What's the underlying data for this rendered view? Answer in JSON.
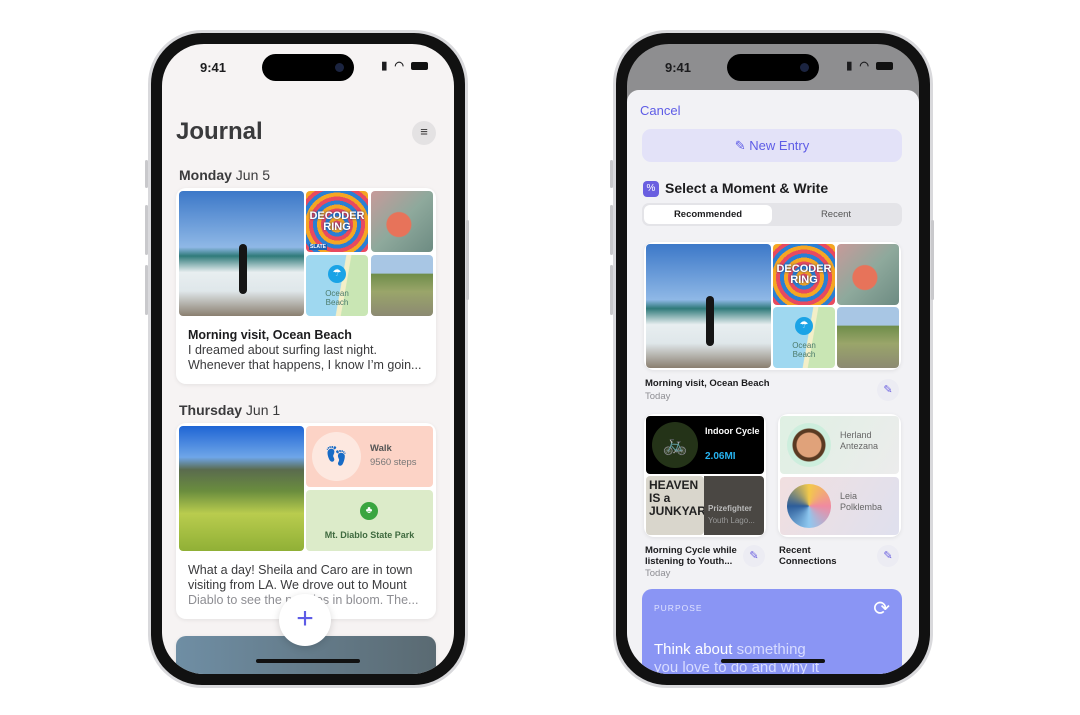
{
  "left_phone": {
    "status": {
      "time": "9:41"
    },
    "title": "Journal",
    "filter_icon": "line.3.horizontal.decrease-icon",
    "sections": [
      {
        "day": "Monday",
        "date": "Jun 5",
        "tiles": {
          "podcast": "DECODER RING",
          "podcast_publisher": "SLATE",
          "map_place": "Ocean Beach"
        },
        "entry_title": "Morning visit, Ocean Beach",
        "entry_lines": [
          "I dreamed about surfing last night.",
          "Whenever that happens, I know I’m goin..."
        ]
      },
      {
        "day": "Thursday",
        "date": "Jun 1",
        "tiles": {
          "activity": "Walk",
          "steps": "9560 steps",
          "map_place": "Mt. Diablo State Park"
        },
        "entry_lines": [
          "What a day! Sheila and Caro are in town",
          "visiting from LA. We drove out to Mount",
          "Diablo to see the poppies in bloom. The..."
        ]
      }
    ],
    "add_button": "+"
  },
  "right_phone": {
    "status": {
      "time": "9:41"
    },
    "cancel": "Cancel",
    "new_entry": "New Entry",
    "section_title": "Select a Moment & Write",
    "segments": [
      "Recommended",
      "Recent"
    ],
    "selected_segment": "Recommended",
    "moment1": {
      "title": "Morning visit, Ocean Beach",
      "subtitle": "Today",
      "podcast": "DECODER RING",
      "map_place": "Ocean Beach"
    },
    "moment2": {
      "workout": "Indoor Cycle",
      "distance": "2.06MI",
      "album": "HEAVEN IS a JUNKYARD",
      "track": "Prizefighter",
      "artist": "Youth Lago...",
      "title": "Morning Cycle while listening to Youth...",
      "subtitle": "Today"
    },
    "moment3": {
      "people": [
        "Herland Antezana",
        "Leia Polklemba"
      ],
      "title": "Recent Connections"
    },
    "purpose": {
      "label": "PURPOSE",
      "prompt_bold": "Think about",
      "prompt_rest": "something",
      "prompt_line2": "you love to do and why it"
    },
    "accent": "#5e5ce6"
  }
}
